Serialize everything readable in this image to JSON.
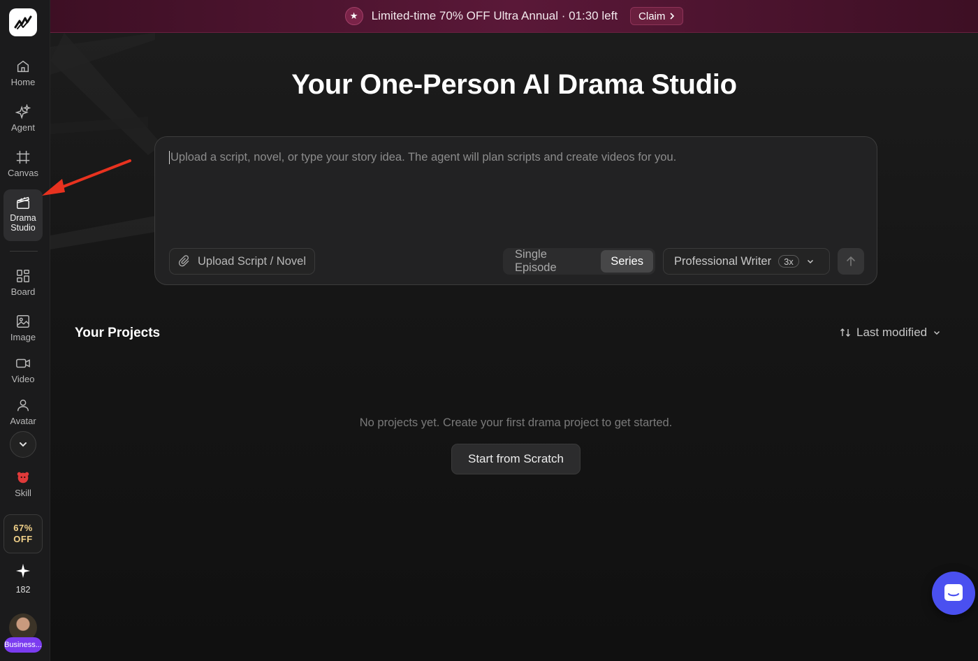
{
  "banner": {
    "promo_text": "Limited-time 70% OFF Ultra Annual · 01:30 left",
    "claim_label": "Claim"
  },
  "sidebar": {
    "items": [
      {
        "label": "Home",
        "icon": "home-icon"
      },
      {
        "label": "Agent",
        "icon": "sparkles-icon"
      },
      {
        "label": "Canvas",
        "icon": "frame-icon"
      },
      {
        "label_line1": "Drama",
        "label_line2": "Studio",
        "icon": "clapperboard-icon",
        "active": true
      },
      {
        "label": "Board",
        "icon": "grid-icon"
      },
      {
        "label": "Image",
        "icon": "image-icon"
      },
      {
        "label": "Video",
        "icon": "video-camera-icon"
      },
      {
        "label": "Avatar",
        "icon": "user-icon"
      },
      {
        "label": "Skill",
        "icon": "skill-mascot-icon"
      }
    ],
    "discount": {
      "line1": "67%",
      "line2": "OFF"
    },
    "credits": "182",
    "plan": "Business..."
  },
  "hero": {
    "title": "Your One-Person AI Drama Studio"
  },
  "composer": {
    "placeholder": "Upload a script, novel, or type your story idea. The agent will plan scripts and create videos for you.",
    "upload_label": "Upload Script / Novel",
    "mode_options": [
      "Single Episode",
      "Series"
    ],
    "selected_mode": "Series",
    "writer_label": "Professional Writer",
    "writer_multiplier": "3x"
  },
  "projects": {
    "title": "Your Projects",
    "sort_label": "Last modified",
    "empty_message": "No projects yet. Create your first drama project to get started.",
    "start_label": "Start from Scratch"
  },
  "colors": {
    "banner_bg": "#5a1838",
    "accent_purple": "#7b3cf0",
    "chat_fab": "#4a50f0",
    "discount_text": "#f2d28a",
    "annotation_arrow": "#e8321f"
  }
}
